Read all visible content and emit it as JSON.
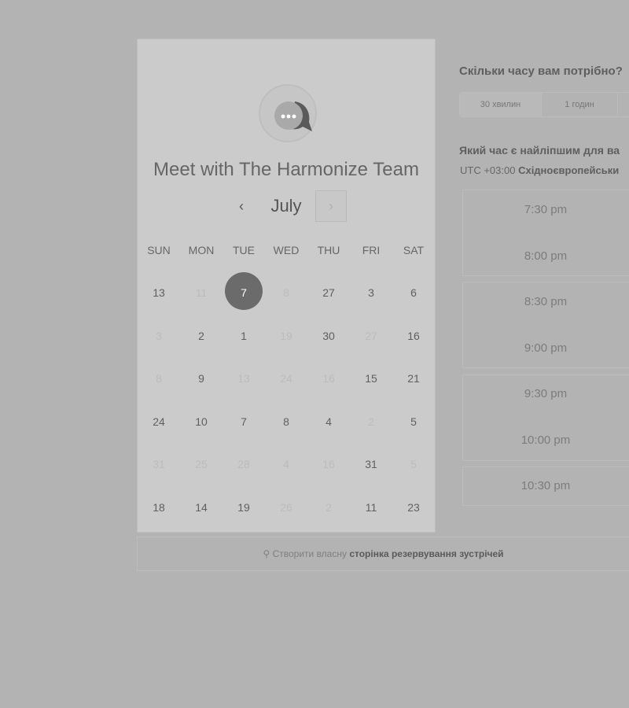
{
  "calendar": {
    "title": "Meet with The Harmonize Team",
    "month": "July",
    "prev_label": "‹",
    "next_label": "›",
    "weekdays": [
      "SUN",
      "MON",
      "TUE",
      "WED",
      "THU",
      "FRI",
      "SAT"
    ],
    "weeks": [
      [
        {
          "d": "13",
          "dim": false
        },
        {
          "d": "11",
          "dim": true
        },
        {
          "d": "7",
          "dim": false,
          "sel": true
        },
        {
          "d": "8",
          "dim": true
        },
        {
          "d": "27",
          "dim": false
        },
        {
          "d": "3",
          "dim": false
        },
        {
          "d": "6",
          "dim": false
        }
      ],
      [
        {
          "d": "3",
          "dim": true
        },
        {
          "d": "2",
          "dim": false
        },
        {
          "d": "1",
          "dim": false
        },
        {
          "d": "19",
          "dim": true
        },
        {
          "d": "30",
          "dim": false
        },
        {
          "d": "27",
          "dim": true
        },
        {
          "d": "16",
          "dim": false
        }
      ],
      [
        {
          "d": "8",
          "dim": true
        },
        {
          "d": "9",
          "dim": false
        },
        {
          "d": "13",
          "dim": true
        },
        {
          "d": "24",
          "dim": true
        },
        {
          "d": "16",
          "dim": true
        },
        {
          "d": "15",
          "dim": false
        },
        {
          "d": "21",
          "dim": false
        }
      ],
      [
        {
          "d": "24",
          "dim": false
        },
        {
          "d": "10",
          "dim": false
        },
        {
          "d": "7",
          "dim": false
        },
        {
          "d": "8",
          "dim": false
        },
        {
          "d": "4",
          "dim": false
        },
        {
          "d": "2",
          "dim": true
        },
        {
          "d": "5",
          "dim": false
        }
      ],
      [
        {
          "d": "31",
          "dim": true
        },
        {
          "d": "25",
          "dim": true
        },
        {
          "d": "28",
          "dim": true
        },
        {
          "d": "4",
          "dim": true
        },
        {
          "d": "16",
          "dim": true
        },
        {
          "d": "31",
          "dim": false
        },
        {
          "d": "5",
          "dim": true
        }
      ],
      [
        {
          "d": "18",
          "dim": false
        },
        {
          "d": "14",
          "dim": false
        },
        {
          "d": "19",
          "dim": false
        },
        {
          "d": "26",
          "dim": true
        },
        {
          "d": "2",
          "dim": true
        },
        {
          "d": "11",
          "dim": false
        },
        {
          "d": "23",
          "dim": false
        }
      ]
    ]
  },
  "booking": {
    "duration_question": "Скільки часу вам потрібно?",
    "durations": [
      "30 хвилин",
      "1 годин"
    ],
    "time_question": "Який час є найліпшим для ва",
    "timezone_prefix": "UTC +03:00",
    "timezone_name": "Східноєвропейськи",
    "slots": [
      "7:30 pm",
      "8:00 pm",
      "8:30 pm",
      "9:00 pm",
      "9:30 pm",
      "10:00 pm",
      "10:30 pm"
    ]
  },
  "footer": {
    "prefix": "Створити власну",
    "link": "сторінка резервування зустрічей"
  },
  "colors": {
    "background": "#b3b3b3",
    "card": "#cbcbcb",
    "selected_day": "#6b6b6b"
  }
}
